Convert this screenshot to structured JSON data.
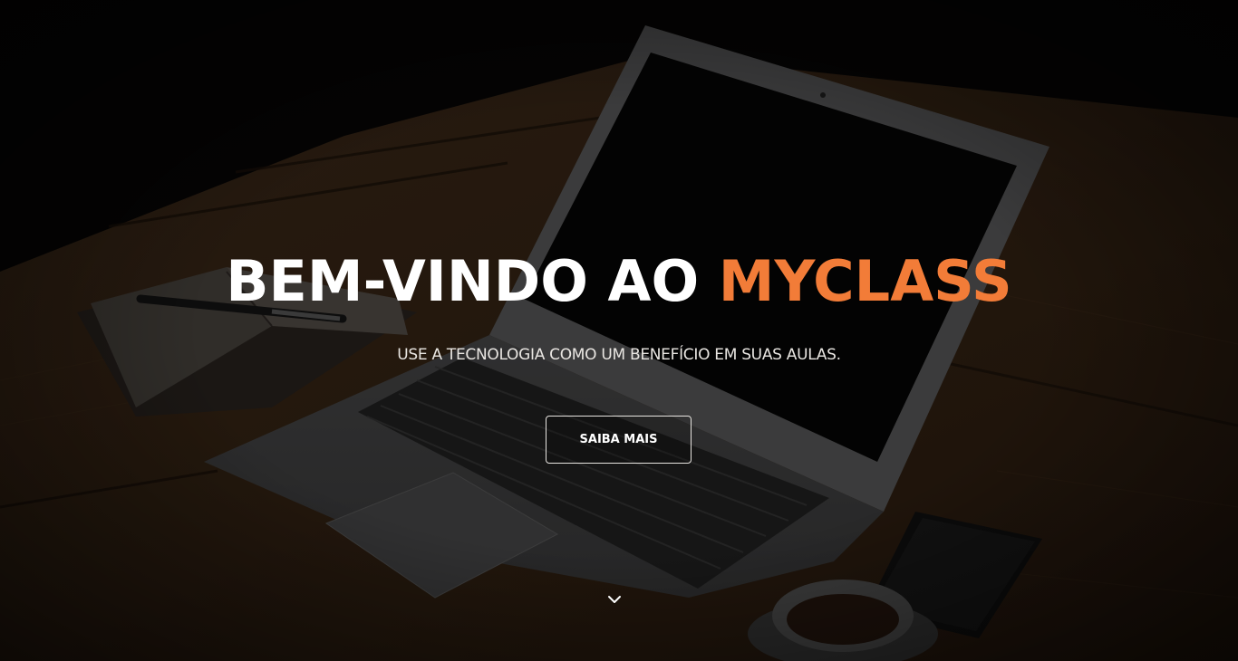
{
  "hero": {
    "headline_prefix": "BEM-VINDO AO ",
    "headline_brand": "MYCLASS",
    "subtitle": "USE A TECNOLOGIA COMO UM BENEFÍCIO EM SUAS AULAS.",
    "cta_label": "SAIBA MAIS",
    "scroll_icon": "chevron-down-icon"
  },
  "colors": {
    "accent": "#f27c38",
    "text": "#ffffff",
    "background": "#0b0907"
  }
}
